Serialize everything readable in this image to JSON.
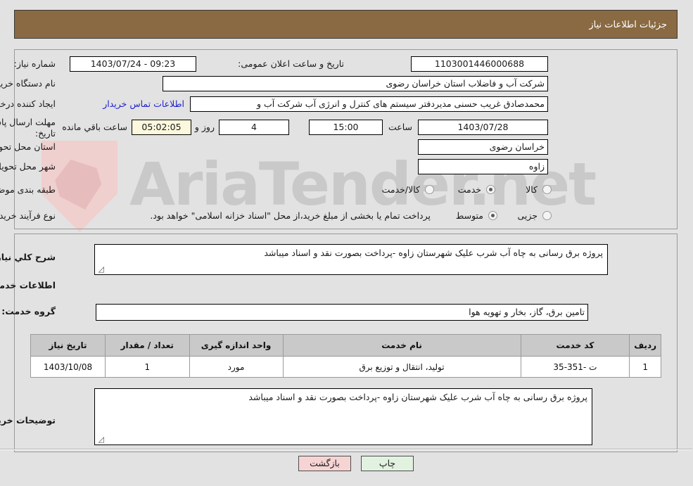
{
  "header": {
    "title": "جزئیات اطلاعات نیاز",
    "bar_color": "#8a6a42"
  },
  "watermark": {
    "text": "AriaTender.net"
  },
  "info": {
    "need_number_label": "شماره نیاز:",
    "need_number_value": "1103001446000688",
    "announce_label": "تاریخ و ساعت اعلان عمومی:",
    "announce_value": "1403/07/24 - 09:23",
    "buyer_org_label": "نام دستگاه خریدار:",
    "buyer_org_value": "شرکت آب و فاضلاب استان خراسان رضوی",
    "creator_label": "ایجاد کننده درخواست:",
    "creator_value": "محمدصادق غریب حسنی مدیردفتر سیستم های کنترل و انرژی آب شرکت آب و",
    "contact_link": "اطلاعات تماس خریدار",
    "deadline_label": "مهلت ارسال پاسخ: تا تاریخ:",
    "deadline_date": "1403/07/28",
    "hour_label": "ساعت",
    "deadline_time": "15:00",
    "days_value": "4",
    "days_label": "روز و",
    "countdown_value": "05:02:05",
    "remaining_label": "ساعت باقي مانده",
    "province_label": "استان محل تحویل:",
    "province_value": "خراسان رضوی",
    "city_label": "شهر محل تحویل:",
    "city_value": "زاوه",
    "category_label": "طبقه بندی موضوعی:",
    "category_options": [
      {
        "label": "کالا",
        "selected": false
      },
      {
        "label": "خدمت",
        "selected": true
      },
      {
        "label": "کالا/خدمت",
        "selected": false
      }
    ],
    "process_label": "نوع فرآیند خرید :",
    "process_options": [
      {
        "label": "جزیی",
        "selected": false
      },
      {
        "label": "متوسط",
        "selected": true
      }
    ],
    "process_note": "پرداخت تمام یا بخشی از مبلغ خرید،از محل \"اسناد خزانه اسلامی\" خواهد بود."
  },
  "need": {
    "summary_label": "شرح کلي نیاز:",
    "summary_value": "پروژه برق رسانی به  چاه آب شرب  علیک شهرستان زاوه  -پرداخت بصورت نقد و اسناد میباشد",
    "services_heading": "اطلاعات خدمات مورد نیاز",
    "service_group_label": "گروه خدمت:",
    "service_group_value": "تامین برق، گاز، بخار و تهویه هوا"
  },
  "table": {
    "columns": [
      "ردیف",
      "کد خدمت",
      "نام خدمت",
      "واحد اندازه گیری",
      "تعداد / مقدار",
      "تاریخ نیاز"
    ],
    "rows": [
      {
        "row": "1",
        "code": "ت -351-35",
        "name": "تولید، انتقال و توزیع برق",
        "unit": "مورد",
        "qty": "1",
        "date": "1403/10/08"
      }
    ]
  },
  "notes": {
    "label": "توضیحات خریدار:",
    "value": "پروژه برق رسانی به  چاه آب شرب  علیک شهرستان زاوه  -پرداخت بصورت نقد و اسناد میباشد"
  },
  "footer": {
    "back_label": "بازگشت",
    "print_label": "چاپ",
    "back_color": "#f6d4d4",
    "print_color": "#e2f2e0"
  }
}
